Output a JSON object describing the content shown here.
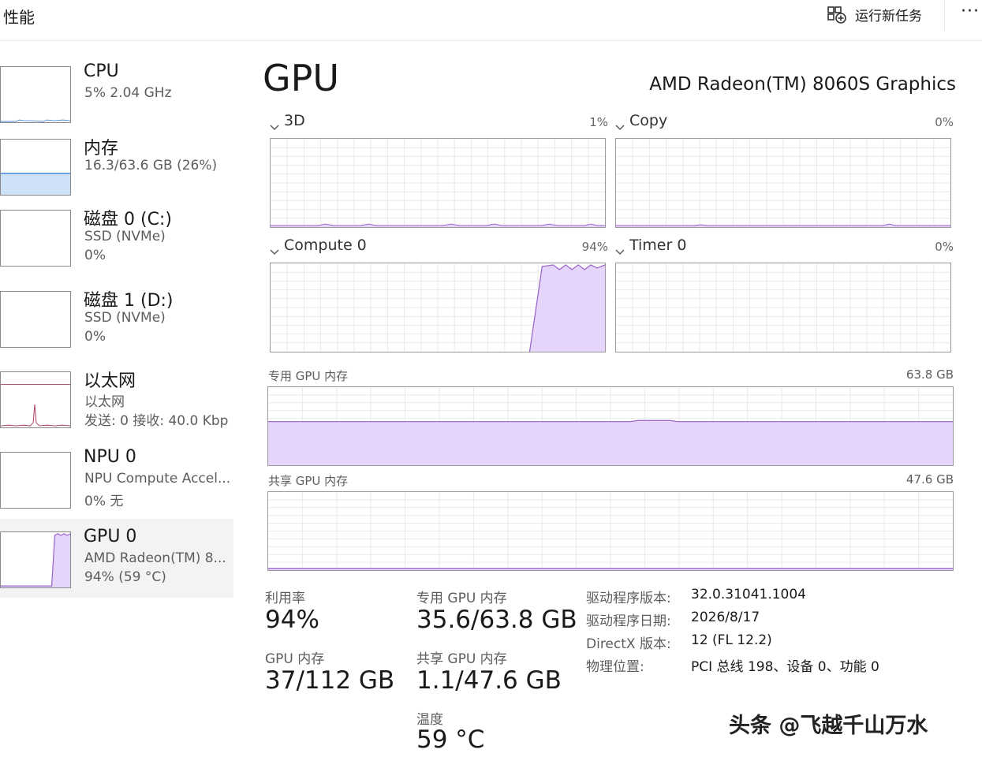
{
  "header": {
    "title": "性能",
    "run_task_label": "运行新任务",
    "more_label": "···"
  },
  "sidebar": {
    "items": [
      {
        "name": "CPU",
        "sub1": "5%  2.04 GHz",
        "sub2": ""
      },
      {
        "name": "内存",
        "sub1": "16.3/63.6 GB (26%)",
        "sub2": ""
      },
      {
        "name": "磁盘 0 (C:)",
        "sub1": "SSD (NVMe)",
        "sub2": "0%"
      },
      {
        "name": "磁盘 1 (D:)",
        "sub1": "SSD (NVMe)",
        "sub2": "0%"
      },
      {
        "name": "以太网",
        "sub1": "以太网",
        "sub2": "发送: 0 接收: 40.0 Kbp"
      },
      {
        "name": "NPU 0",
        "sub1": "NPU Compute Accel...",
        "sub2": "0% 无"
      },
      {
        "name": "GPU 0",
        "sub1": "AMD Radeon(TM) 8...",
        "sub2": "94% (59 °C)"
      }
    ],
    "selected_index": 6
  },
  "main": {
    "heading": "GPU",
    "model": "AMD Radeon(TM) 8060S Graphics",
    "engines": [
      {
        "label": "3D",
        "percent": "1%"
      },
      {
        "label": "Copy",
        "percent": "0%"
      },
      {
        "label": "Compute 0",
        "percent": "94%"
      },
      {
        "label": "Timer 0",
        "percent": "0%"
      }
    ],
    "dedicated_mem": {
      "label": "专用 GPU 内存",
      "max": "63.8 GB",
      "usage_fraction": 0.558
    },
    "shared_mem": {
      "label": "共享 GPU 内存",
      "max": "47.6 GB",
      "usage_fraction": 0.023
    },
    "stats": {
      "utilization": {
        "label": "利用率",
        "value": "94%"
      },
      "dedicated": {
        "label": "专用 GPU 内存",
        "value": "35.6/63.8 GB"
      },
      "gpu_memory": {
        "label": "GPU 内存",
        "value": "37/112 GB"
      },
      "shared": {
        "label": "共享 GPU 内存",
        "value": "1.1/47.6 GB"
      },
      "temperature": {
        "label": "温度",
        "value": "59 °C"
      }
    },
    "info": [
      {
        "key": "驱动程序版本:",
        "value": "32.0.31041.1004"
      },
      {
        "key": "驱动程序日期:",
        "value": "2026/8/17"
      },
      {
        "key": "DirectX 版本:",
        "value": "12 (FL 12.2)"
      },
      {
        "key": "物理位置:",
        "value": "PCI 总线 198、设备 0、功能 0"
      }
    ]
  },
  "colors": {
    "gpu_line": "#9660c8",
    "gpu_fill": "#e6d5fb",
    "mem_line": "#4a8ad8",
    "mem_fill": "#cfe1f8",
    "cpu_line": "#4a8ad8",
    "net_line": "#a93d62",
    "grid": "#e9e9e9"
  },
  "watermark": "头条 @飞越千山万水"
}
